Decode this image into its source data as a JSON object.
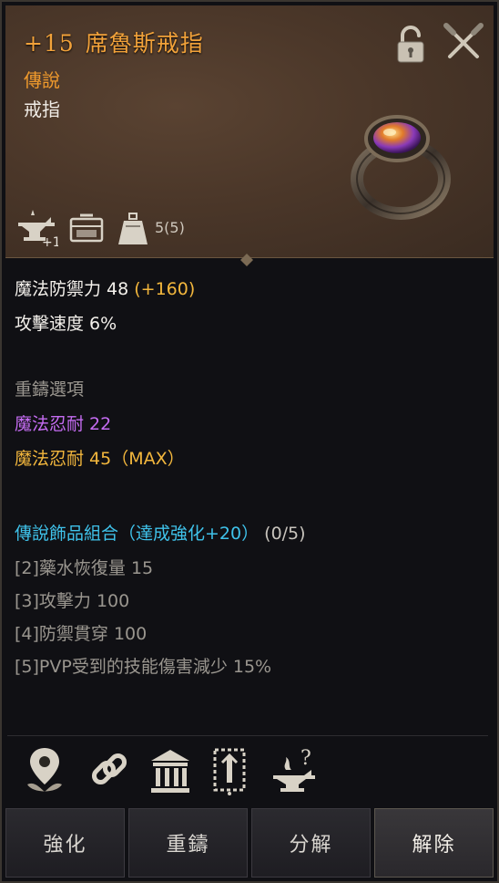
{
  "item": {
    "enhance": "+15",
    "name": "席魯斯戒指",
    "grade": "傳說",
    "type": "戒指",
    "weight": "5(5)",
    "upgrade_badge": "+1"
  },
  "stats": {
    "mdef_label": "魔法防禦力 48",
    "mdef_bonus": "(+160)",
    "atk_speed": "攻擊速度 6%"
  },
  "reforge": {
    "title": "重鑄選項",
    "opt1": "魔法忍耐 22",
    "opt2": "魔法忍耐 45（MAX）"
  },
  "set": {
    "title": "傳說飾品組合（達成強化+20）",
    "progress": "(0/5)",
    "bonuses": [
      "[2]藥水恢復量 15",
      "[3]攻擊力 100",
      "[4]防禦貫穿 100",
      "[5]PVP受到的技能傷害減少 15%"
    ]
  },
  "tools": [
    "location-icon",
    "link-icon",
    "warehouse-icon",
    "codex-icon",
    "anvil-help-icon"
  ],
  "buttons": {
    "enhance": "強化",
    "reforge": "重鑄",
    "decompose": "分解",
    "unequip": "解除"
  },
  "colors": {
    "legendary": "#f09a2c",
    "bonus": "#f3b73d",
    "reforge_option": "#c56cf2",
    "set_title": "#3fc2ea"
  }
}
